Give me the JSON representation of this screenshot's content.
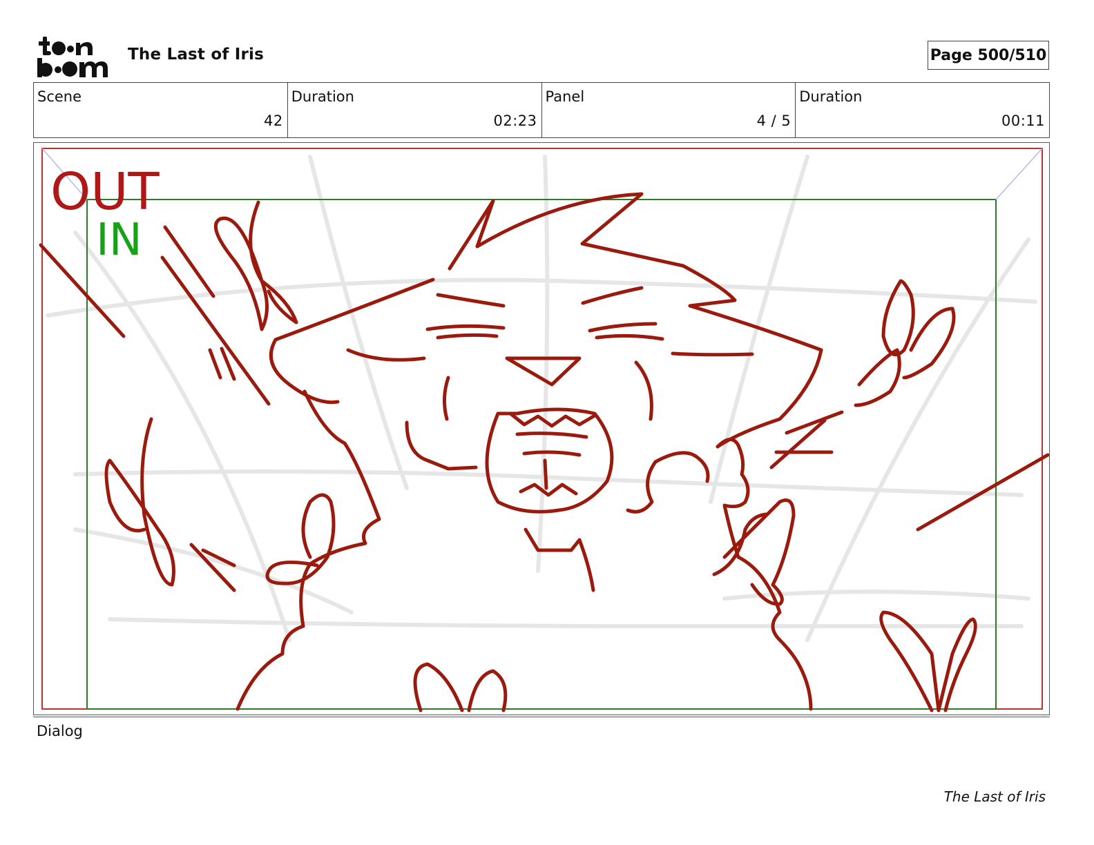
{
  "header": {
    "logo_text": "toonboom",
    "project_title": "The Last of Iris",
    "page_label": "Page 500/510"
  },
  "info": {
    "scene_label": "Scene",
    "scene_value": "42",
    "scene_duration_label": "Duration",
    "scene_duration_value": "02:23",
    "panel_label": "Panel",
    "panel_value": "4 / 5",
    "panel_duration_label": "Duration",
    "panel_duration_value": "00:11"
  },
  "panel": {
    "out_label": "OUT",
    "in_label": "IN",
    "out_color": "#b01818",
    "in_color": "#17a317",
    "sketch_color": "#9a1a0e"
  },
  "dialog": {
    "label": "Dialog"
  },
  "footer": {
    "title": "The Last of Iris"
  }
}
